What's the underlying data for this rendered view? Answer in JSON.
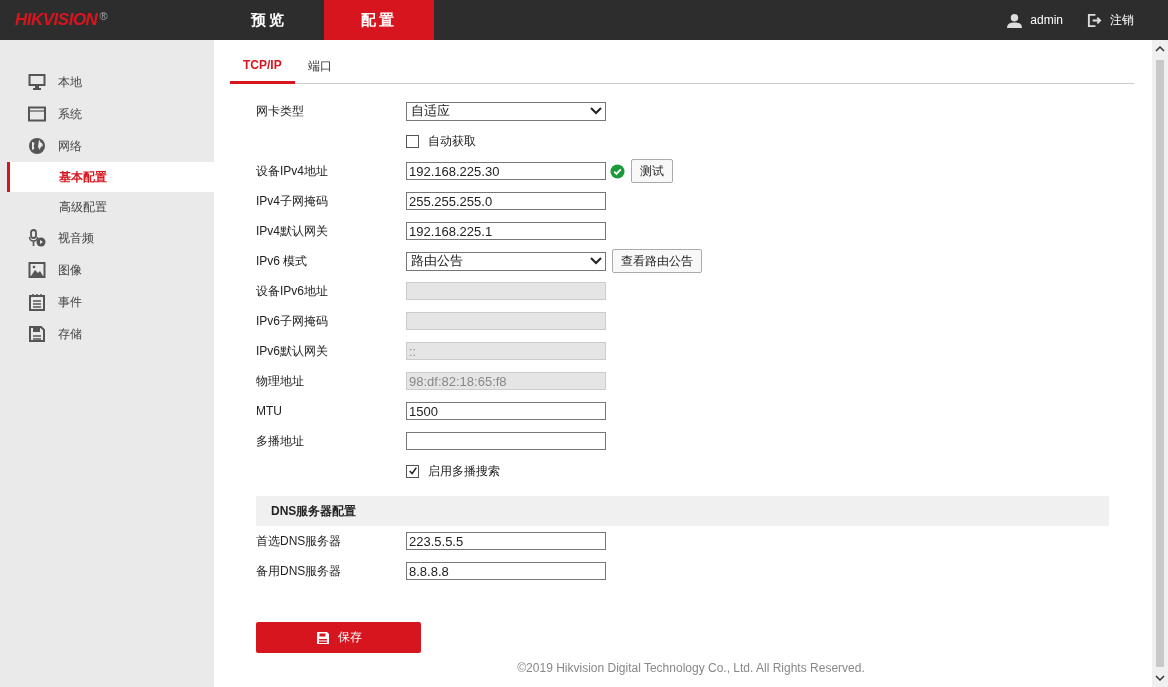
{
  "header": {
    "logo": "HIKVISION",
    "logo_mark": "®",
    "tabs": [
      {
        "label": "预览",
        "selected": false
      },
      {
        "label": "配置",
        "selected": true
      }
    ],
    "user": "admin",
    "logout": "注销"
  },
  "sidebar": {
    "items": [
      {
        "label": "本地",
        "selected": false
      },
      {
        "label": "系统",
        "selected": false
      },
      {
        "label": "网络",
        "selected": false,
        "children": [
          {
            "label": "基本配置",
            "selected": true
          },
          {
            "label": "高级配置",
            "selected": false
          }
        ]
      },
      {
        "label": "视音频",
        "selected": false
      },
      {
        "label": "图像",
        "selected": false
      },
      {
        "label": "事件",
        "selected": false
      },
      {
        "label": "存储",
        "selected": false
      }
    ]
  },
  "subtabs": [
    {
      "label": "TCP/IP",
      "selected": true
    },
    {
      "label": "端口",
      "selected": false
    }
  ],
  "form": [
    {
      "kind": "select",
      "label": "网卡类型",
      "value": "自适应"
    },
    {
      "kind": "checkbox",
      "label": "自动获取",
      "checked": false
    },
    {
      "kind": "text",
      "label": "设备IPv4地址",
      "value": "192.168.225.30",
      "verified": true,
      "button": "测试"
    },
    {
      "kind": "text",
      "label": "IPv4子网掩码",
      "value": "255.255.255.0"
    },
    {
      "kind": "text",
      "label": "IPv4默认网关",
      "value": "192.168.225.1"
    },
    {
      "kind": "select",
      "label": "IPv6 模式",
      "value": "路由公告",
      "button": "查看路由公告"
    },
    {
      "kind": "text",
      "label": "设备IPv6地址",
      "disabled": true
    },
    {
      "kind": "text",
      "label": "IPv6子网掩码",
      "disabled": true
    },
    {
      "kind": "text",
      "label": "IPv6默认网关",
      "value": "::",
      "disabled": true
    },
    {
      "kind": "text",
      "label": "物理地址",
      "value": "98:df:82:18:65:f8",
      "disabled": true
    },
    {
      "kind": "text",
      "label": "MTU",
      "value": "1500"
    },
    {
      "kind": "text",
      "label": "多播地址"
    },
    {
      "kind": "checkbox",
      "label": "启用多播搜索",
      "checked": true
    }
  ],
  "dns": {
    "title": "DNS服务器配置",
    "fields": [
      {
        "kind": "text",
        "label": "首选DNS服务器",
        "value": "223.5.5.5"
      },
      {
        "kind": "text",
        "label": "备用DNS服务器",
        "value": "8.8.8.8"
      }
    ]
  },
  "save_button": "保存",
  "footer": "©2019 Hikvision Digital Technology Co., Ltd. All Rights Reserved."
}
